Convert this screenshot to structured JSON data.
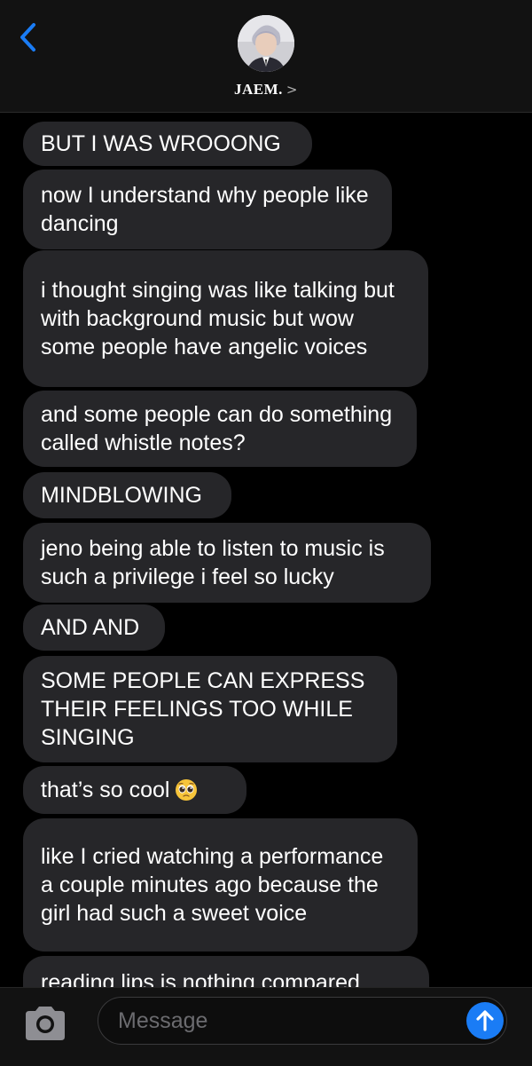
{
  "header": {
    "contact_name": "JAEM.",
    "contact_chevron": ">",
    "back_icon": "chevron-left-icon",
    "accent_color": "#1a7cf5"
  },
  "messages": [
    {
      "text": "BUT I WAS WROOONG"
    },
    {
      "text": "now I understand why people like dancing"
    },
    {
      "text": "i thought singing was like talking but with background music but wow some people have angelic voices"
    },
    {
      "text": "and some people can do something called whistle notes?"
    },
    {
      "text": "MINDBLOWING"
    },
    {
      "text": "jeno being able to listen to music is such a privilege i feel so lucky"
    },
    {
      "text": "AND AND"
    },
    {
      "text": "SOME PEOPLE CAN EXPRESS THEIR FEELINGS TOO WHILE SINGING"
    },
    {
      "text": "that’s so cool",
      "emoji": "pleading-face-emoji"
    },
    {
      "text": "like I cried watching a performance a couple minutes ago because the girl had such a sweet voice"
    },
    {
      "text": "reading lips is nothing compared"
    }
  ],
  "composer": {
    "placeholder": "Message",
    "camera_icon": "camera-icon",
    "send_icon": "arrow-up-icon"
  }
}
